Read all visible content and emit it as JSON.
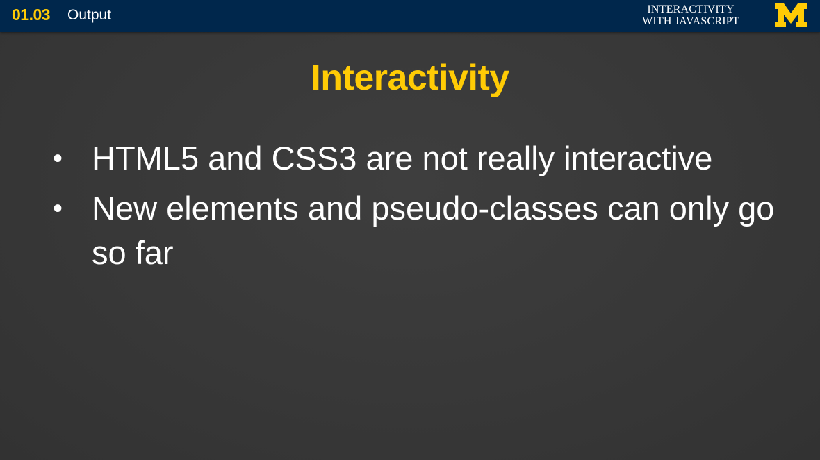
{
  "header": {
    "lesson_number": "01.03",
    "lesson_title": "Output",
    "course_title_line1": "INTERACTIVITY",
    "course_title_line2": "WITH JAVASCRIPT",
    "logo_icon": "university-m-logo-icon",
    "logo_letter": "M"
  },
  "slide": {
    "title": "Interactivity",
    "bullets": [
      {
        "text": "HTML5 and CSS3 are not really interactive"
      },
      {
        "text": "New elements and pseudo-classes can only go so far"
      }
    ]
  },
  "colors": {
    "header_bg": "#00274c",
    "accent_maize": "#ffcb05",
    "slide_bg": "#3a3a3a",
    "text": "#ffffff"
  }
}
